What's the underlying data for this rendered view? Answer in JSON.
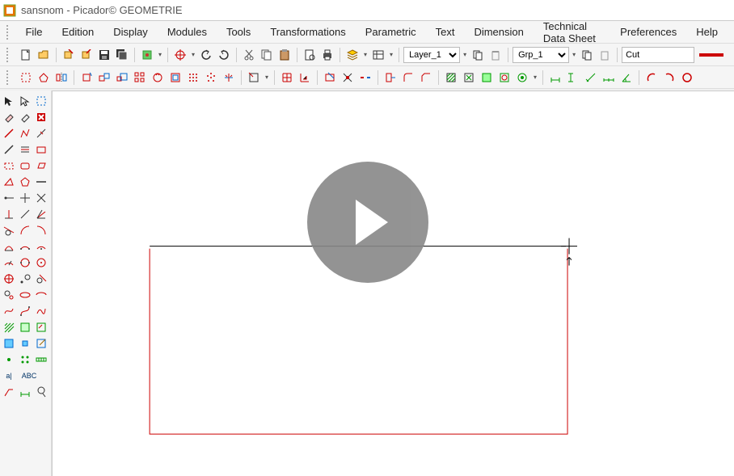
{
  "window": {
    "title": "sansnom - Picador© GEOMETRIE"
  },
  "menu": {
    "file": "File",
    "edition": "Edition",
    "display": "Display",
    "modules": "Modules",
    "tools": "Tools",
    "transformations": "Transformations",
    "parametric": "Parametric",
    "text": "Text",
    "dimension": "Dimension",
    "technical_data_sheet": "Technical Data Sheet",
    "preferences": "Preferences",
    "help": "Help"
  },
  "toolbar1": {
    "layer_value": "Layer_1",
    "group_value": "Grp_1",
    "line_type": "Cut"
  },
  "sidebar_labels": {
    "a": "a|",
    "abc": "ABC"
  },
  "colors": {
    "accent_red": "#c00",
    "brand_orange": "#e87400"
  }
}
